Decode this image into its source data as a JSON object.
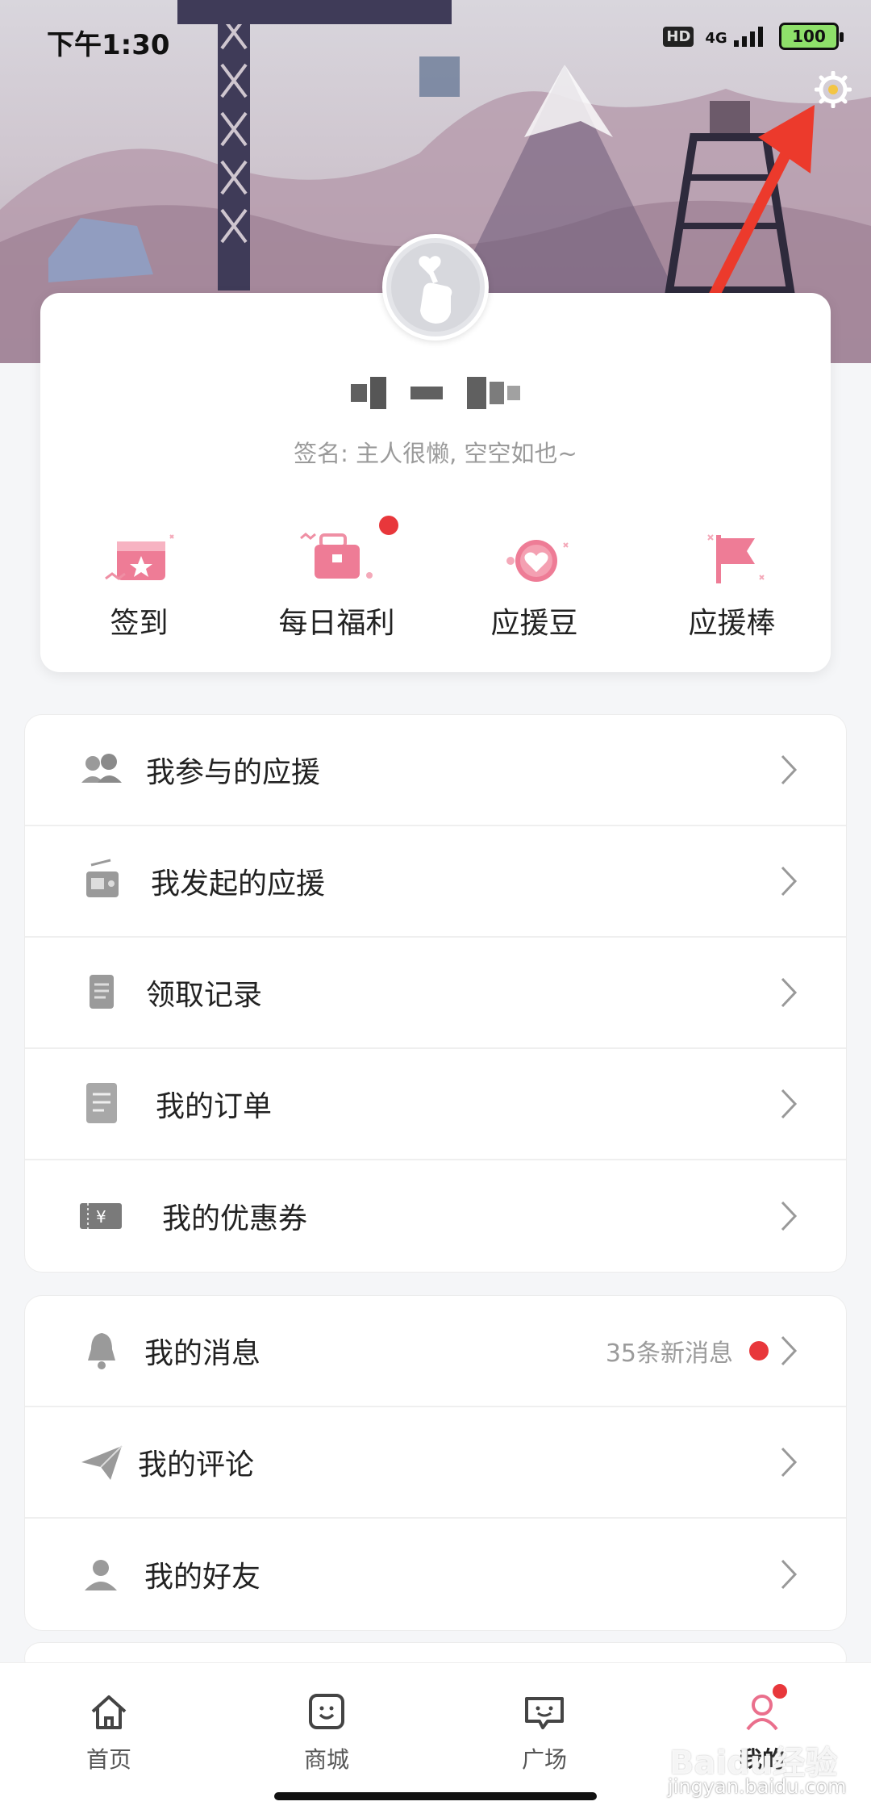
{
  "status_bar": {
    "time": "下午1:30",
    "hd": "HD",
    "network": "4G",
    "battery": "100"
  },
  "profile": {
    "signature": "签名: 主人很懒, 空空如也~"
  },
  "quick_actions": [
    {
      "label": "签到",
      "icon": "calendar-check-icon",
      "badge": false
    },
    {
      "label": "每日福利",
      "icon": "gift-bag-icon",
      "badge": true
    },
    {
      "label": "应援豆",
      "icon": "heart-bean-icon",
      "badge": false
    },
    {
      "label": "应援棒",
      "icon": "flag-icon",
      "badge": false
    }
  ],
  "menu_group_1": [
    {
      "label": "我参与的应援",
      "icon": "people-icon"
    },
    {
      "label": "我发起的应援",
      "icon": "radio-icon"
    },
    {
      "label": "领取记录",
      "icon": "document-icon"
    },
    {
      "label": "我的订单",
      "icon": "order-icon"
    },
    {
      "label": "我的优惠券",
      "icon": "coupon-icon"
    }
  ],
  "menu_group_2": [
    {
      "label": "我的消息",
      "icon": "bell-icon",
      "extra": "35条新消息",
      "dot": true
    },
    {
      "label": "我的评论",
      "icon": "paper-plane-icon"
    },
    {
      "label": "我的好友",
      "icon": "friend-icon"
    }
  ],
  "bottom_nav": [
    {
      "label": "首页",
      "icon": "home-icon",
      "active": false
    },
    {
      "label": "商城",
      "icon": "shop-icon",
      "active": false
    },
    {
      "label": "广场",
      "icon": "square-chat-icon",
      "active": false
    },
    {
      "label": "我的",
      "icon": "profile-icon",
      "active": true
    }
  ],
  "colors": {
    "accent_red": "#e8373b",
    "pink_icon": "#ea6f8c"
  },
  "watermark": {
    "brand": "Baidu经验",
    "url": "jingyan.baidu.com"
  }
}
